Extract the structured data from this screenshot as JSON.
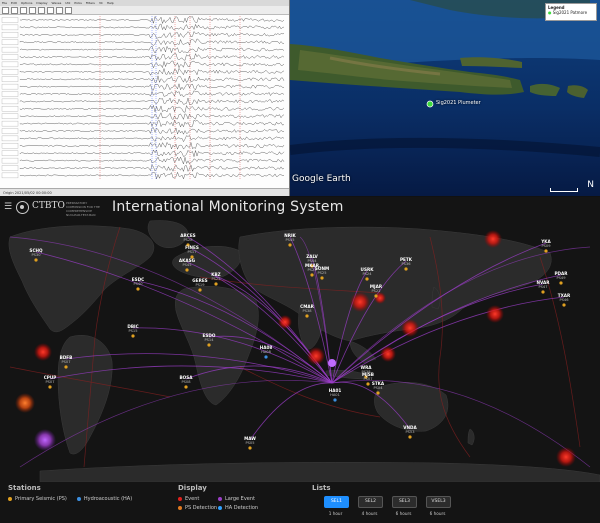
{
  "seismogram": {
    "menu": [
      "File",
      "Edit",
      "Options",
      "Display",
      "Waves",
      "Util",
      "Picks",
      "Filters",
      "3C",
      "Help"
    ],
    "status": "Origin 2021/05/02 00:00:00"
  },
  "satellite": {
    "legend_title": "Legend",
    "legend_item": "Sig2021 Patmore",
    "pin_label": "Sig2021 Plumeter",
    "google_label": "Google Earth",
    "compass": "N"
  },
  "ims": {
    "org_name": "CTBTO",
    "org_sub": "PREPARATORY COMMISSION FOR THE COMPREHENSIVE NUCLEAR-TEST-BAN TREATY ORGANIZATION",
    "title": "International Monitoring System",
    "stations": [
      {
        "name": "SCHQ",
        "code": "PS30"
      },
      {
        "name": "ARCES",
        "code": "PS28"
      },
      {
        "name": "FINES",
        "code": "PS17"
      },
      {
        "name": "AKASG",
        "code": "PS45"
      },
      {
        "name": "ESDC",
        "code": "PS40"
      },
      {
        "name": "KBZ",
        "code": "PS22"
      },
      {
        "name": "GERES",
        "code": "PS19"
      },
      {
        "name": "NRIK",
        "code": "PS45"
      },
      {
        "name": "ZALV",
        "code": "PS44"
      },
      {
        "name": "MKAR",
        "code": "PS23"
      },
      {
        "name": "SONM",
        "code": "PS25"
      },
      {
        "name": "USRK",
        "code": "PS24"
      },
      {
        "name": "PETK",
        "code": "PS36"
      },
      {
        "name": "MJAR",
        "code": "PS22"
      },
      {
        "name": "YKA",
        "code": "PS09"
      },
      {
        "name": "PDAR",
        "code": "PS49"
      },
      {
        "name": "NVAR",
        "code": "PS47"
      },
      {
        "name": "TXAR",
        "code": "PS46"
      },
      {
        "name": "CMAR",
        "code": "PS38"
      },
      {
        "name": "DBIC",
        "code": "PS15"
      },
      {
        "name": "ESDO",
        "code": "PS14"
      },
      {
        "name": "HA08",
        "code": "HA08"
      },
      {
        "name": "BOSA",
        "code": "PS08"
      },
      {
        "name": "BDFB",
        "code": "PS07"
      },
      {
        "name": "CPUP",
        "code": "PS07"
      },
      {
        "name": "WRA",
        "code": "PS38"
      },
      {
        "name": "MJSB",
        "code": "PS07"
      },
      {
        "name": "STKA",
        "code": "PS04"
      },
      {
        "name": "HA01",
        "code": "HA01"
      },
      {
        "name": "MAW",
        "code": "PS05"
      },
      {
        "name": "VNDA",
        "code": "PS53"
      }
    ],
    "legend": {
      "stations_heading": "Stations",
      "primary": "Primary Seismic (PS)",
      "hydro": "Hydroacoustic (HA)",
      "display_heading": "Display",
      "event": "Event",
      "large_event": "Large Event",
      "ps_detection": "PS Detection",
      "ha_detection": "HA Detection",
      "lists_heading": "Lists",
      "sel1": "SEL1",
      "sel2": "SEL2",
      "sel3": "SEL3",
      "vsel3": "VSEL3",
      "h1": "1 hour",
      "h4": "4 hours",
      "h6": "6 hours",
      "h6b": "6 hours"
    },
    "colors": {
      "event": "#e0201c",
      "large_event": "#9b3ec8",
      "ps": "#e0a020",
      "ha": "#3c8fe0",
      "ps_det": "#e07a20",
      "ha_det": "#2fa0ff",
      "active_button": "#1e8fff"
    }
  }
}
